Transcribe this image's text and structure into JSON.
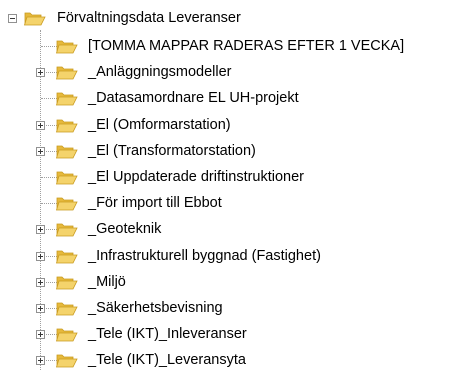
{
  "tree": {
    "root": {
      "label": "Förvaltningsdata Leveranser",
      "expanded": true
    },
    "children": [
      {
        "label": "[TOMMA MAPPAR RADERAS EFTER 1 VECKA]",
        "has_children": false
      },
      {
        "label": "_Anläggningsmodeller",
        "has_children": true
      },
      {
        "label": "_Datasamordnare EL UH-projekt",
        "has_children": false
      },
      {
        "label": "_El (Omformarstation)",
        "has_children": true
      },
      {
        "label": "_El (Transformatorstation)",
        "has_children": true
      },
      {
        "label": "_El Uppdaterade driftinstruktioner",
        "has_children": false
      },
      {
        "label": "_För import till Ebbot",
        "has_children": false
      },
      {
        "label": "_Geoteknik",
        "has_children": true
      },
      {
        "label": "_Infrastrukturell byggnad (Fastighet)",
        "has_children": true
      },
      {
        "label": "_Miljö",
        "has_children": true
      },
      {
        "label": "_Säkerhetsbevisning",
        "has_children": true
      },
      {
        "label": "_Tele (IKT)_Inleveranser",
        "has_children": true
      },
      {
        "label": "_Tele (IKT)_Leveransyta",
        "has_children": true
      }
    ]
  },
  "colors": {
    "folder_fill": "#f4d36b",
    "folder_back": "#e6b93c",
    "folder_stroke": "#c99a1e",
    "connector": "#a0a0a0",
    "toggle_border": "#919191"
  },
  "icons": {
    "folder": "folder-icon",
    "expand": "plus-box-icon",
    "collapse": "minus-box-icon"
  }
}
